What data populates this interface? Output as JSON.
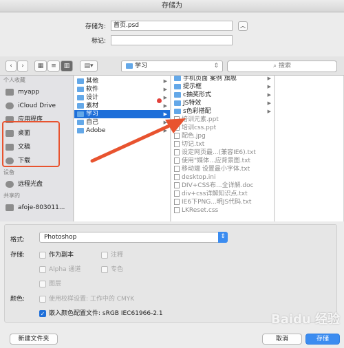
{
  "window": {
    "title": "存储为"
  },
  "form": {
    "save_as_label": "存储为:",
    "save_as_value": "首页.psd",
    "tags_label": "标记:",
    "tags_value": ""
  },
  "toolbar": {
    "path": "学习",
    "search_placeholder": "搜索"
  },
  "sidebar": {
    "favorites_heading": "个人收藏",
    "favorites": [
      "myapp",
      "iCloud Drive",
      "应用程序",
      "桌面",
      "文稿",
      "下载"
    ],
    "devices_heading": "设备",
    "devices": [
      "远程光盘"
    ],
    "shared_heading": "共享的",
    "shared": [
      "afoje-803011..."
    ]
  },
  "column1": [
    {
      "name": "其他",
      "folder": true
    },
    {
      "name": "软件",
      "folder": true
    },
    {
      "name": "设计",
      "folder": true
    },
    {
      "name": "素材",
      "folder": true
    },
    {
      "name": "学习",
      "folder": true,
      "selected": true
    },
    {
      "name": "自己",
      "folder": true
    },
    {
      "name": "Adobe",
      "folder": true
    }
  ],
  "column2": [
    {
      "name": "手机页面 案例 旗舰",
      "folder": true
    },
    {
      "name": "提示框",
      "folder": true
    },
    {
      "name": "c抽奖形式",
      "folder": true
    },
    {
      "name": "JS特效",
      "folder": true
    },
    {
      "name": "s色彩搭配",
      "folder": true
    },
    {
      "name": "培训元素.ppt",
      "folder": false
    },
    {
      "name": "培训css.ppt",
      "folder": false
    },
    {
      "name": "配色.jpg",
      "folder": false
    },
    {
      "name": "切记.txt",
      "folder": false
    },
    {
      "name": "设定网页最...(兼容IE6).txt",
      "folder": false
    },
    {
      "name": "使用\"媒体...应背景图.txt",
      "folder": false
    },
    {
      "name": "移动端 设置最小字体.txt",
      "folder": false
    },
    {
      "name": "desktop.ini",
      "folder": false
    },
    {
      "name": "DIV+CSS布...全详解.doc",
      "folder": false
    },
    {
      "name": "div+css详解知识点.txt",
      "folder": false
    },
    {
      "name": "IE6下PNG...明JS代码.txt",
      "folder": false
    },
    {
      "name": "LKReset.css",
      "folder": false
    }
  ],
  "options": {
    "format_label": "格式:",
    "format_value": "Photoshop",
    "storage_label": "存储:",
    "as_copy": "作为副本",
    "notes": "注释",
    "alpha": "Alpha 通道",
    "spot": "专色",
    "layers": "图层",
    "color_label": "颜色:",
    "proof": "使用校样设置: 工作中的 CMYK",
    "embed_profile": "嵌入颜色配置文件: sRGB IEC61966-2.1"
  },
  "buttons": {
    "new_folder": "新建文件夹",
    "cancel": "取消",
    "save": "存储"
  },
  "watermark": "Baidu 经验"
}
